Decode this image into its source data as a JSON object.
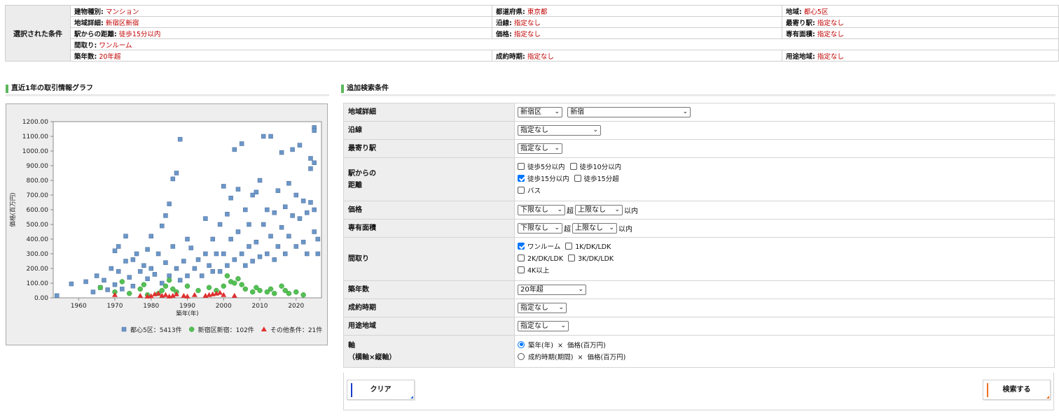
{
  "selected": {
    "header": "選択された条件",
    "rows": [
      [
        [
          "建物種別:",
          "マンション"
        ],
        [
          "都道府県:",
          "東京都"
        ],
        [
          "地域:",
          "都心5区"
        ]
      ],
      [
        [
          "地域詳細:",
          "新宿区新宿"
        ],
        [
          "沿線:",
          "指定なし"
        ],
        [
          "最寄り駅:",
          "指定なし"
        ]
      ],
      [
        [
          "駅からの距離:",
          "徒歩15分以内"
        ],
        [
          "価格:",
          "指定なし"
        ],
        [
          "専有面積:",
          "指定なし"
        ]
      ],
      [
        [
          "間取り:",
          "ワンルーム"
        ]
      ],
      [
        [
          "築年数:",
          "20年超"
        ],
        [
          "成約時期:",
          "指定なし"
        ],
        [
          "用途地域:",
          "指定なし"
        ]
      ]
    ]
  },
  "graph_title": "直近1年の取引情報グラフ",
  "form_title": "追加検索条件",
  "chart_data": {
    "type": "scatter",
    "xlabel": "築年(年)",
    "ylabel": "価格(百万円)",
    "xlim": [
      1953,
      2027
    ],
    "ylim": [
      0,
      1200
    ],
    "x_ticks": [
      1960,
      1970,
      1980,
      1990,
      2000,
      2010,
      2020
    ],
    "y_ticks": [
      "0.00",
      "100.00",
      "200.00",
      "300.00",
      "400.00",
      "500.00",
      "600.00",
      "700.00",
      "800.00",
      "900.00",
      "1000.00",
      "1100.00",
      "1200.00"
    ],
    "grid": false,
    "legend_position": "bottom",
    "series": [
      {
        "name": "都心5区：5413件",
        "marker": "square",
        "color": "#6c96c8",
        "points": [
          [
            1954,
            15
          ],
          [
            1958,
            95
          ],
          [
            1962,
            110
          ],
          [
            1964,
            40
          ],
          [
            1965,
            150
          ],
          [
            1966,
            70
          ],
          [
            1967,
            120
          ],
          [
            1968,
            55
          ],
          [
            1969,
            200
          ],
          [
            1970,
            320
          ],
          [
            1970,
            90
          ],
          [
            1971,
            350
          ],
          [
            1971,
            180
          ],
          [
            1972,
            60
          ],
          [
            1973,
            420
          ],
          [
            1973,
            250
          ],
          [
            1974,
            140
          ],
          [
            1975,
            260
          ],
          [
            1975,
            80
          ],
          [
            1976,
            300
          ],
          [
            1977,
            180
          ],
          [
            1978,
            220
          ],
          [
            1979,
            330
          ],
          [
            1979,
            130
          ],
          [
            1980,
            200
          ],
          [
            1980,
            420
          ],
          [
            1981,
            160
          ],
          [
            1982,
            300
          ],
          [
            1983,
            490
          ],
          [
            1983,
            100
          ],
          [
            1984,
            560
          ],
          [
            1984,
            240
          ],
          [
            1985,
            640
          ],
          [
            1985,
            150
          ],
          [
            1986,
            810
          ],
          [
            1986,
            350
          ],
          [
            1987,
            850
          ],
          [
            1987,
            200
          ],
          [
            1988,
            1080
          ],
          [
            1988,
            120
          ],
          [
            1989,
            250
          ],
          [
            1990,
            400
          ],
          [
            1990,
            150
          ],
          [
            1991,
            340
          ],
          [
            1992,
            200
          ],
          [
            1993,
            260
          ],
          [
            1994,
            150
          ],
          [
            1995,
            540
          ],
          [
            1995,
            300
          ],
          [
            1996,
            220
          ],
          [
            1997,
            400
          ],
          [
            1997,
            180
          ],
          [
            1998,
            300
          ],
          [
            1999,
            500
          ],
          [
            1999,
            180
          ],
          [
            2000,
            760
          ],
          [
            2000,
            300
          ],
          [
            2001,
            570
          ],
          [
            2001,
            220
          ],
          [
            2002,
            680
          ],
          [
            2002,
            400
          ],
          [
            2003,
            1010
          ],
          [
            2003,
            260
          ],
          [
            2004,
            740
          ],
          [
            2004,
            450
          ],
          [
            2005,
            1050
          ],
          [
            2005,
            300
          ],
          [
            2006,
            600
          ],
          [
            2006,
            220
          ],
          [
            2007,
            500
          ],
          [
            2007,
            350
          ],
          [
            2008,
            700
          ],
          [
            2008,
            250
          ],
          [
            2009,
            720
          ],
          [
            2009,
            380
          ],
          [
            2010,
            800
          ],
          [
            2010,
            280
          ],
          [
            2011,
            1100
          ],
          [
            2011,
            500
          ],
          [
            2012,
            600
          ],
          [
            2012,
            300
          ],
          [
            2013,
            1100
          ],
          [
            2013,
            420
          ],
          [
            2014,
            580
          ],
          [
            2014,
            260
          ],
          [
            2015,
            730
          ],
          [
            2015,
            350
          ],
          [
            2016,
            990
          ],
          [
            2016,
            480
          ],
          [
            2017,
            620
          ],
          [
            2017,
            300
          ],
          [
            2018,
            780
          ],
          [
            2018,
            420
          ],
          [
            2019,
            1010
          ],
          [
            2019,
            560
          ],
          [
            2020,
            700
          ],
          [
            2020,
            350
          ],
          [
            2021,
            1040
          ],
          [
            2021,
            540
          ],
          [
            2022,
            660
          ],
          [
            2022,
            380
          ],
          [
            2023,
            580
          ],
          [
            2023,
            300
          ],
          [
            2024,
            950
          ],
          [
            2024,
            650
          ],
          [
            2024,
            880
          ],
          [
            2025,
            1160
          ],
          [
            2025,
            1140
          ],
          [
            2025,
            920
          ],
          [
            2025,
            600
          ],
          [
            2025,
            450
          ],
          [
            2026,
            400
          ],
          [
            2026,
            300
          ]
        ]
      },
      {
        "name": "新宿区新宿：102件",
        "marker": "circle",
        "color": "#55c055",
        "points": [
          [
            1966,
            70
          ],
          [
            1970,
            40
          ],
          [
            1972,
            110
          ],
          [
            1974,
            30
          ],
          [
            1977,
            60
          ],
          [
            1978,
            90
          ],
          [
            1979,
            20
          ],
          [
            1982,
            30
          ],
          [
            1983,
            50
          ],
          [
            1984,
            80
          ],
          [
            1985,
            120
          ],
          [
            1986,
            60
          ],
          [
            1987,
            40
          ],
          [
            1990,
            80
          ],
          [
            1993,
            50
          ],
          [
            1996,
            70
          ],
          [
            1998,
            50
          ],
          [
            2000,
            80
          ],
          [
            2001,
            150
          ],
          [
            2002,
            110
          ],
          [
            2003,
            100
          ],
          [
            2004,
            130
          ],
          [
            2005,
            90
          ],
          [
            2006,
            60
          ],
          [
            2008,
            40
          ],
          [
            2009,
            70
          ],
          [
            2010,
            50
          ],
          [
            2012,
            40
          ],
          [
            2013,
            60
          ],
          [
            2014,
            30
          ],
          [
            2016,
            80
          ],
          [
            2017,
            50
          ],
          [
            2018,
            30
          ],
          [
            2020,
            40
          ],
          [
            2022,
            20
          ]
        ]
      },
      {
        "name": "その他条件：21件",
        "marker": "triangle",
        "color": "#e03030",
        "points": [
          [
            1970,
            20
          ],
          [
            1977,
            15
          ],
          [
            1979,
            10
          ],
          [
            1980,
            12
          ],
          [
            1981,
            25
          ],
          [
            1982,
            30
          ],
          [
            1983,
            15
          ],
          [
            1984,
            20
          ],
          [
            1985,
            10
          ],
          [
            1986,
            15
          ],
          [
            1987,
            25
          ],
          [
            1989,
            15
          ],
          [
            1990,
            10
          ],
          [
            1992,
            20
          ],
          [
            1995,
            15
          ],
          [
            1996,
            20
          ],
          [
            1997,
            25
          ],
          [
            1998,
            30
          ],
          [
            1999,
            35
          ],
          [
            2000,
            20
          ],
          [
            2003,
            15
          ]
        ]
      }
    ]
  },
  "form": {
    "area_label": "地域詳細",
    "area_select1": "新宿区",
    "area_select2": "新宿",
    "line_label": "沿線",
    "line_select": "指定なし",
    "station_label": "最寄り駅",
    "station_select": "指定なし",
    "distance_label_1": "駅からの",
    "distance_label_2": "距離",
    "distance_options": [
      {
        "label": "徒歩5分以内",
        "checked": false
      },
      {
        "label": "徒歩10分以内",
        "checked": false
      },
      {
        "label": "徒歩15分以内",
        "checked": true
      },
      {
        "label": "徒歩15分超",
        "checked": false
      },
      {
        "label": "バス",
        "checked": false
      }
    ],
    "price_label": "価格",
    "price_min": "下限なし",
    "price_max": "上限なし",
    "area_size_label": "専有面積",
    "size_min": "下限なし",
    "size_max": "上限なし",
    "over": "超",
    "within": "以内",
    "layout_label": "間取り",
    "layout_options": [
      {
        "label": "ワンルーム",
        "checked": true
      },
      {
        "label": "1K/DK/LDK",
        "checked": false
      },
      {
        "label": "2K/DK/LDK",
        "checked": false
      },
      {
        "label": "3K/DK/LDK",
        "checked": false
      },
      {
        "label": "4K以上",
        "checked": false
      }
    ],
    "age_label": "築年数",
    "age_select": "20年超",
    "period_label": "成約時期",
    "period_select": "指定なし",
    "zoning_label": "用途地域",
    "zoning_select": "指定なし",
    "axis_label_1": "軸",
    "axis_label_2": "（横軸×縦軸）",
    "axis_options": [
      {
        "label": "築年(年)  ×  価格(百万円)",
        "checked": true
      },
      {
        "label": "成約時期(期間)  ×  価格(百万円)",
        "checked": false
      }
    ]
  },
  "buttons": {
    "clear": "クリア",
    "search": "検索する"
  }
}
